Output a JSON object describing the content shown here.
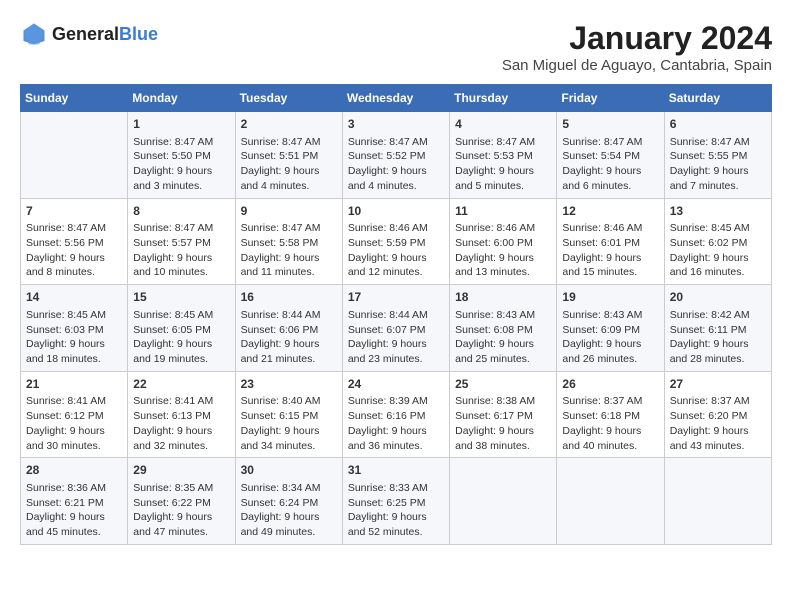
{
  "header": {
    "logo_general": "General",
    "logo_blue": "Blue",
    "month": "January 2024",
    "location": "San Miguel de Aguayo, Cantabria, Spain"
  },
  "days_of_week": [
    "Sunday",
    "Monday",
    "Tuesday",
    "Wednesday",
    "Thursday",
    "Friday",
    "Saturday"
  ],
  "weeks": [
    [
      {
        "day": "",
        "content": ""
      },
      {
        "day": "1",
        "content": "Sunrise: 8:47 AM\nSunset: 5:50 PM\nDaylight: 9 hours\nand 3 minutes."
      },
      {
        "day": "2",
        "content": "Sunrise: 8:47 AM\nSunset: 5:51 PM\nDaylight: 9 hours\nand 4 minutes."
      },
      {
        "day": "3",
        "content": "Sunrise: 8:47 AM\nSunset: 5:52 PM\nDaylight: 9 hours\nand 4 minutes."
      },
      {
        "day": "4",
        "content": "Sunrise: 8:47 AM\nSunset: 5:53 PM\nDaylight: 9 hours\nand 5 minutes."
      },
      {
        "day": "5",
        "content": "Sunrise: 8:47 AM\nSunset: 5:54 PM\nDaylight: 9 hours\nand 6 minutes."
      },
      {
        "day": "6",
        "content": "Sunrise: 8:47 AM\nSunset: 5:55 PM\nDaylight: 9 hours\nand 7 minutes."
      }
    ],
    [
      {
        "day": "7",
        "content": "Sunrise: 8:47 AM\nSunset: 5:56 PM\nDaylight: 9 hours\nand 8 minutes."
      },
      {
        "day": "8",
        "content": "Sunrise: 8:47 AM\nSunset: 5:57 PM\nDaylight: 9 hours\nand 10 minutes."
      },
      {
        "day": "9",
        "content": "Sunrise: 8:47 AM\nSunset: 5:58 PM\nDaylight: 9 hours\nand 11 minutes."
      },
      {
        "day": "10",
        "content": "Sunrise: 8:46 AM\nSunset: 5:59 PM\nDaylight: 9 hours\nand 12 minutes."
      },
      {
        "day": "11",
        "content": "Sunrise: 8:46 AM\nSunset: 6:00 PM\nDaylight: 9 hours\nand 13 minutes."
      },
      {
        "day": "12",
        "content": "Sunrise: 8:46 AM\nSunset: 6:01 PM\nDaylight: 9 hours\nand 15 minutes."
      },
      {
        "day": "13",
        "content": "Sunrise: 8:45 AM\nSunset: 6:02 PM\nDaylight: 9 hours\nand 16 minutes."
      }
    ],
    [
      {
        "day": "14",
        "content": "Sunrise: 8:45 AM\nSunset: 6:03 PM\nDaylight: 9 hours\nand 18 minutes."
      },
      {
        "day": "15",
        "content": "Sunrise: 8:45 AM\nSunset: 6:05 PM\nDaylight: 9 hours\nand 19 minutes."
      },
      {
        "day": "16",
        "content": "Sunrise: 8:44 AM\nSunset: 6:06 PM\nDaylight: 9 hours\nand 21 minutes."
      },
      {
        "day": "17",
        "content": "Sunrise: 8:44 AM\nSunset: 6:07 PM\nDaylight: 9 hours\nand 23 minutes."
      },
      {
        "day": "18",
        "content": "Sunrise: 8:43 AM\nSunset: 6:08 PM\nDaylight: 9 hours\nand 25 minutes."
      },
      {
        "day": "19",
        "content": "Sunrise: 8:43 AM\nSunset: 6:09 PM\nDaylight: 9 hours\nand 26 minutes."
      },
      {
        "day": "20",
        "content": "Sunrise: 8:42 AM\nSunset: 6:11 PM\nDaylight: 9 hours\nand 28 minutes."
      }
    ],
    [
      {
        "day": "21",
        "content": "Sunrise: 8:41 AM\nSunset: 6:12 PM\nDaylight: 9 hours\nand 30 minutes."
      },
      {
        "day": "22",
        "content": "Sunrise: 8:41 AM\nSunset: 6:13 PM\nDaylight: 9 hours\nand 32 minutes."
      },
      {
        "day": "23",
        "content": "Sunrise: 8:40 AM\nSunset: 6:15 PM\nDaylight: 9 hours\nand 34 minutes."
      },
      {
        "day": "24",
        "content": "Sunrise: 8:39 AM\nSunset: 6:16 PM\nDaylight: 9 hours\nand 36 minutes."
      },
      {
        "day": "25",
        "content": "Sunrise: 8:38 AM\nSunset: 6:17 PM\nDaylight: 9 hours\nand 38 minutes."
      },
      {
        "day": "26",
        "content": "Sunrise: 8:37 AM\nSunset: 6:18 PM\nDaylight: 9 hours\nand 40 minutes."
      },
      {
        "day": "27",
        "content": "Sunrise: 8:37 AM\nSunset: 6:20 PM\nDaylight: 9 hours\nand 43 minutes."
      }
    ],
    [
      {
        "day": "28",
        "content": "Sunrise: 8:36 AM\nSunset: 6:21 PM\nDaylight: 9 hours\nand 45 minutes."
      },
      {
        "day": "29",
        "content": "Sunrise: 8:35 AM\nSunset: 6:22 PM\nDaylight: 9 hours\nand 47 minutes."
      },
      {
        "day": "30",
        "content": "Sunrise: 8:34 AM\nSunset: 6:24 PM\nDaylight: 9 hours\nand 49 minutes."
      },
      {
        "day": "31",
        "content": "Sunrise: 8:33 AM\nSunset: 6:25 PM\nDaylight: 9 hours\nand 52 minutes."
      },
      {
        "day": "",
        "content": ""
      },
      {
        "day": "",
        "content": ""
      },
      {
        "day": "",
        "content": ""
      }
    ]
  ]
}
